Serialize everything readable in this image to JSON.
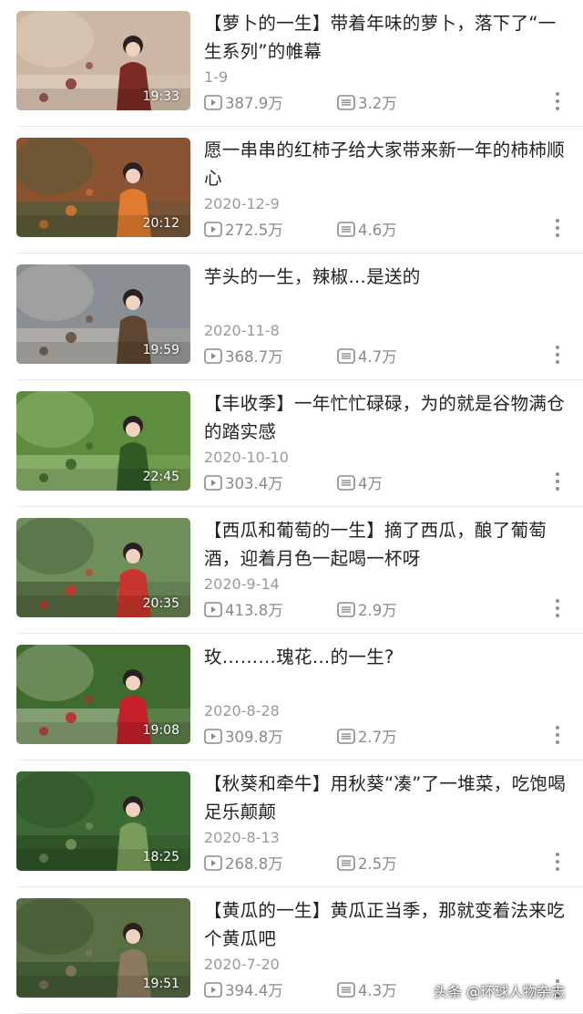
{
  "videos": [
    {
      "title": "【萝卜的一生】带着年味的萝卜，落下了“一生系列”的帷幕",
      "date": "1-9",
      "views": "387.9万",
      "comments": "3.2万",
      "duration": "19:33",
      "palette": [
        "#cbb7a3",
        "#7c2b24",
        "#e7d6c6"
      ]
    },
    {
      "title": "愿一串串的红柿子给大家带来新一年的柿柿顺心",
      "date": "2020-12-9",
      "views": "272.5万",
      "comments": "4.6万",
      "duration": "20:12",
      "palette": [
        "#8a5433",
        "#e07a2e",
        "#3b5c3a"
      ]
    },
    {
      "title": "芋头的一生，辣椒…是送的",
      "date": "2020-11-8",
      "views": "368.7万",
      "comments": "4.7万",
      "duration": "19:59",
      "palette": [
        "#8a8f93",
        "#5e4632",
        "#c9c2b6"
      ]
    },
    {
      "title": "【丰收季】一年忙忙碌碌，为的就是谷物满仓的踏实感",
      "date": "2020-10-10",
      "views": "303.4万",
      "comments": "4万",
      "duration": "22:45",
      "palette": [
        "#5d8e3e",
        "#2f5a26",
        "#a9c98a"
      ]
    },
    {
      "title": "【西瓜和葡萄的一生】摘了西瓜，酿了葡萄酒，迎着月色一起喝一杯呀",
      "date": "2020-9-14",
      "views": "413.8万",
      "comments": "2.9万",
      "duration": "20:35",
      "palette": [
        "#6f8f5a",
        "#c8352c",
        "#3a4a2e"
      ]
    },
    {
      "title": "玫………瑰花…的一生?",
      "date": "2020-8-28",
      "views": "309.8万",
      "comments": "2.7万",
      "duration": "19:08",
      "palette": [
        "#3f6b2f",
        "#c51f2a",
        "#b9c7a5"
      ]
    },
    {
      "title": "【秋葵和牵牛】用秋葵“凑”了一堆菜，吃饱喝足乐颠颠",
      "date": "2020-8-13",
      "views": "268.8万",
      "comments": "2.5万",
      "duration": "18:25",
      "palette": [
        "#3c6a33",
        "#7a9c5b",
        "#25411f"
      ]
    },
    {
      "title": "【黄瓜的一生】黄瓜正当季，那就变着法来吃个黄瓜吧",
      "date": "2020-7-20",
      "views": "394.4万",
      "comments": "4.3万",
      "duration": "19:51",
      "palette": [
        "#5a6e43",
        "#8b7a5e",
        "#2e4a2a"
      ]
    }
  ],
  "watermark": "头条 @环球人物杂志"
}
